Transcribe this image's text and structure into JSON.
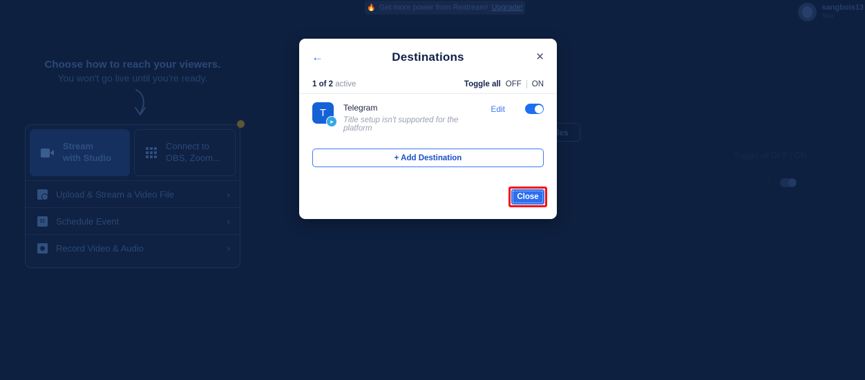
{
  "promo_banner": {
    "icon": "flame-icon",
    "text": "Get more power from Restream!",
    "link_label": "Upgrade!"
  },
  "user": {
    "name": "sangbois13",
    "role": "You",
    "avatar_icon": "avatar-icon"
  },
  "left_panel": {
    "title": "Choose how to reach your viewers.",
    "subtitle": "You won't go live until you're ready.",
    "arrow_icon": "curved-down-arrow-icon",
    "choices": [
      {
        "label": "Stream\nwith Studio",
        "icon": "video-camera-icon",
        "selected": true
      },
      {
        "label": "Connect to\nOBS, Zoom...",
        "icon": "grid-apps-icon",
        "selected": false
      }
    ],
    "menu": [
      {
        "label": "Upload & Stream a Video File",
        "icon": "upload-video-icon",
        "chevron": "›"
      },
      {
        "label": "Schedule Event",
        "icon": "calendar-icon",
        "chevron": "›"
      },
      {
        "label": "Record Video & Audio",
        "icon": "record-icon",
        "chevron": "›"
      }
    ]
  },
  "background_behind_modal": {
    "subtitles_fragment": "tles",
    "toggle_all_text": "Toggle all  OFF | ON"
  },
  "modal": {
    "title": "Destinations",
    "back_icon": "back-arrow-icon",
    "close_icon": "close-x-icon",
    "status": {
      "count_bold": "1 of 2",
      "count_rest": " active"
    },
    "toggle_all": {
      "label": "Toggle all",
      "off": "OFF",
      "on": "ON"
    },
    "destinations": [
      {
        "name": "Telegram",
        "note": "Title setup isn't supported for the platform",
        "avatar_letter": "T",
        "badge_icon": "telegram-plane-icon",
        "edit_label": "Edit",
        "enabled": true
      }
    ],
    "add_destination_label": "+ Add Destination",
    "close_label": "Close"
  },
  "colors": {
    "page_background": "#0e2040",
    "accent_blue": "#2d6ef0",
    "link_blue": "#3d7af5",
    "highlight_red": "#ff0d0d",
    "telegram_blue": "#1462d6",
    "modal_background": "#ffffff"
  }
}
